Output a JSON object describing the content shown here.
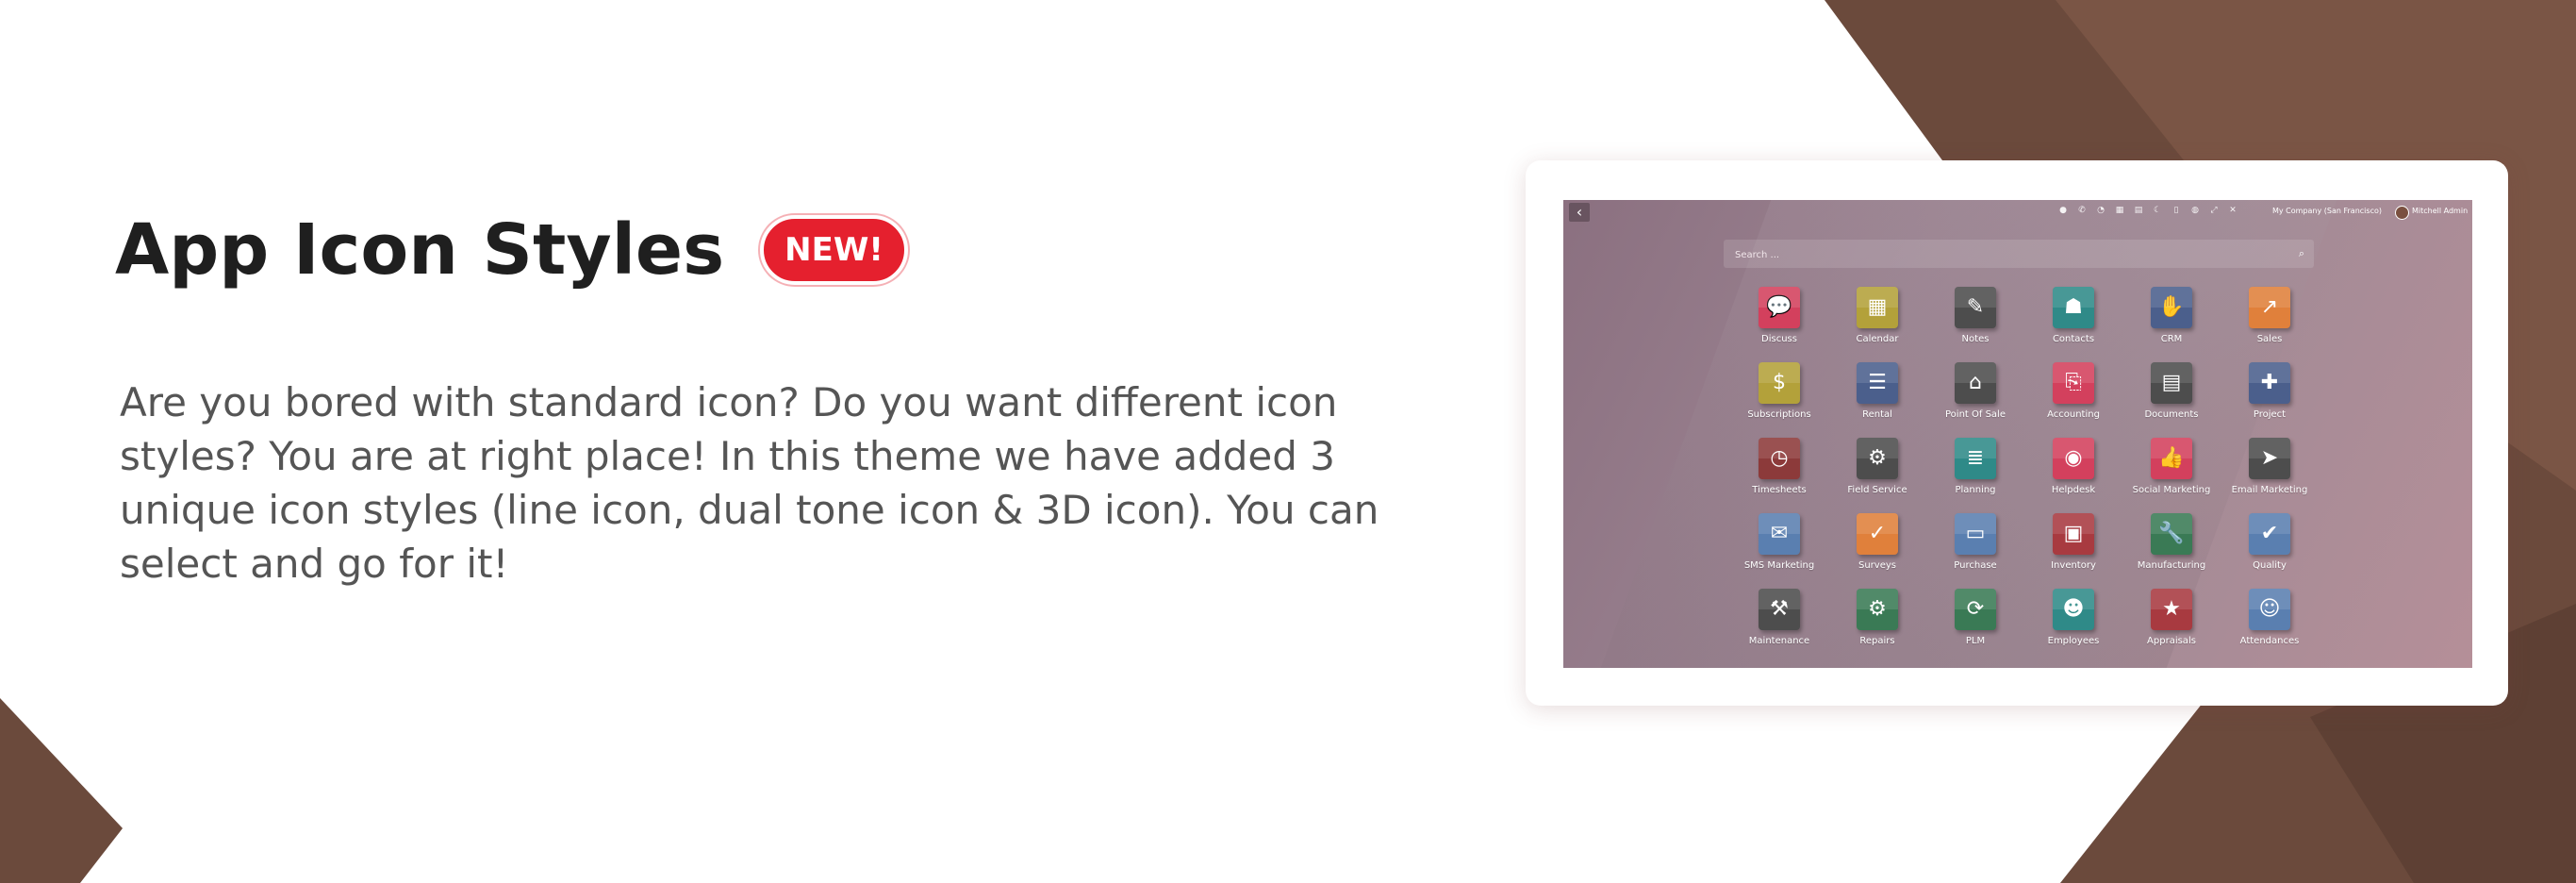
{
  "hero": {
    "title": "App Icon Styles",
    "badge": "NEW!",
    "description": "Are you bored with standard icon? Do you want different icon styles? You are at right place! In this theme we have added 3 unique icon styles (line icon, dual tone icon & 3D icon). You can select and go for it!"
  },
  "colors": {
    "brown_dark": "#6b4a3c",
    "brown_mid": "#7d5647",
    "badge_red": "#e5202e",
    "screen_bg": "#9a8290"
  },
  "odoo": {
    "back_icon": "chevron-left-icon",
    "company": "My Company (San Francisco)",
    "user": "Mitchell Admin",
    "system_icons": [
      "chat-icon",
      "phone-icon",
      "activity-icon",
      "calendar-icon",
      "print-icon",
      "moon-icon",
      "clipboard-icon",
      "database-icon",
      "expand-icon",
      "tools-icon"
    ],
    "search_placeholder": "Search ...",
    "apps": [
      {
        "label": "Discuss",
        "icon": "chat-bubble-icon",
        "glyph": "💬",
        "color": "#d3405d"
      },
      {
        "label": "Calendar",
        "icon": "calendar-icon",
        "glyph": "▦",
        "color": "#b3a13a"
      },
      {
        "label": "Notes",
        "icon": "notes-icon",
        "glyph": "✎",
        "color": "#4d4d4d"
      },
      {
        "label": "Contacts",
        "icon": "contacts-icon",
        "glyph": "☗",
        "color": "#2f8a88"
      },
      {
        "label": "CRM",
        "icon": "handshake-icon",
        "glyph": "✋",
        "color": "#4b5f8c"
      },
      {
        "label": "Sales",
        "icon": "chart-icon",
        "glyph": "↗",
        "color": "#e0803b"
      },
      {
        "label": "Subscriptions",
        "icon": "coin-icon",
        "glyph": "$",
        "color": "#b3a13a"
      },
      {
        "label": "Rental",
        "icon": "rental-icon",
        "glyph": "☰",
        "color": "#4b5f8c"
      },
      {
        "label": "Point Of Sale",
        "icon": "store-icon",
        "glyph": "⌂",
        "color": "#4d4d4d"
      },
      {
        "label": "Accounting",
        "icon": "document-icon",
        "glyph": "⎘",
        "color": "#d3405d"
      },
      {
        "label": "Documents",
        "icon": "folder-icon",
        "glyph": "▤",
        "color": "#4d4d4d"
      },
      {
        "label": "Project",
        "icon": "puzzle-icon",
        "glyph": "✚",
        "color": "#4b5f8c"
      },
      {
        "label": "Timesheets",
        "icon": "stopwatch-icon",
        "glyph": "◷",
        "color": "#8c3a3a"
      },
      {
        "label": "Field Service",
        "icon": "service-icon",
        "glyph": "⚙",
        "color": "#4d4d4d"
      },
      {
        "label": "Planning",
        "icon": "planning-icon",
        "glyph": "≣",
        "color": "#2f8a88"
      },
      {
        "label": "Helpdesk",
        "icon": "lifebuoy-icon",
        "glyph": "◉",
        "color": "#d3405d"
      },
      {
        "label": "Social Marketing",
        "icon": "thumbs-up-icon",
        "glyph": "👍",
        "color": "#d3405d"
      },
      {
        "label": "Email Marketing",
        "icon": "paper-plane-icon",
        "glyph": "➤",
        "color": "#4d4d4d"
      },
      {
        "label": "SMS Marketing",
        "icon": "sms-icon",
        "glyph": "✉",
        "color": "#5a7fb0"
      },
      {
        "label": "Surveys",
        "icon": "survey-icon",
        "glyph": "✓",
        "color": "#e0803b"
      },
      {
        "label": "Purchase",
        "icon": "credit-card-icon",
        "glyph": "▭",
        "color": "#5a7fb0"
      },
      {
        "label": "Inventory",
        "icon": "box-icon",
        "glyph": "▣",
        "color": "#a83a40"
      },
      {
        "label": "Manufacturing",
        "icon": "wrench-icon",
        "glyph": "🔧",
        "color": "#3a7a55"
      },
      {
        "label": "Quality",
        "icon": "gear-check-icon",
        "glyph": "✔",
        "color": "#5a7fb0"
      },
      {
        "label": "Maintenance",
        "icon": "hammer-icon",
        "glyph": "⚒",
        "color": "#4d4d4d"
      },
      {
        "label": "Repairs",
        "icon": "repair-icon",
        "glyph": "⚙",
        "color": "#3a7a55"
      },
      {
        "label": "PLM",
        "icon": "cycle-icon",
        "glyph": "⟳",
        "color": "#3a7a55"
      },
      {
        "label": "Employees",
        "icon": "people-icon",
        "glyph": "☻",
        "color": "#2f8a88"
      },
      {
        "label": "Appraisals",
        "icon": "star-icon",
        "glyph": "★",
        "color": "#a83a40"
      },
      {
        "label": "Attendances",
        "icon": "user-clock-icon",
        "glyph": "☺",
        "color": "#5a7fb0"
      }
    ]
  }
}
